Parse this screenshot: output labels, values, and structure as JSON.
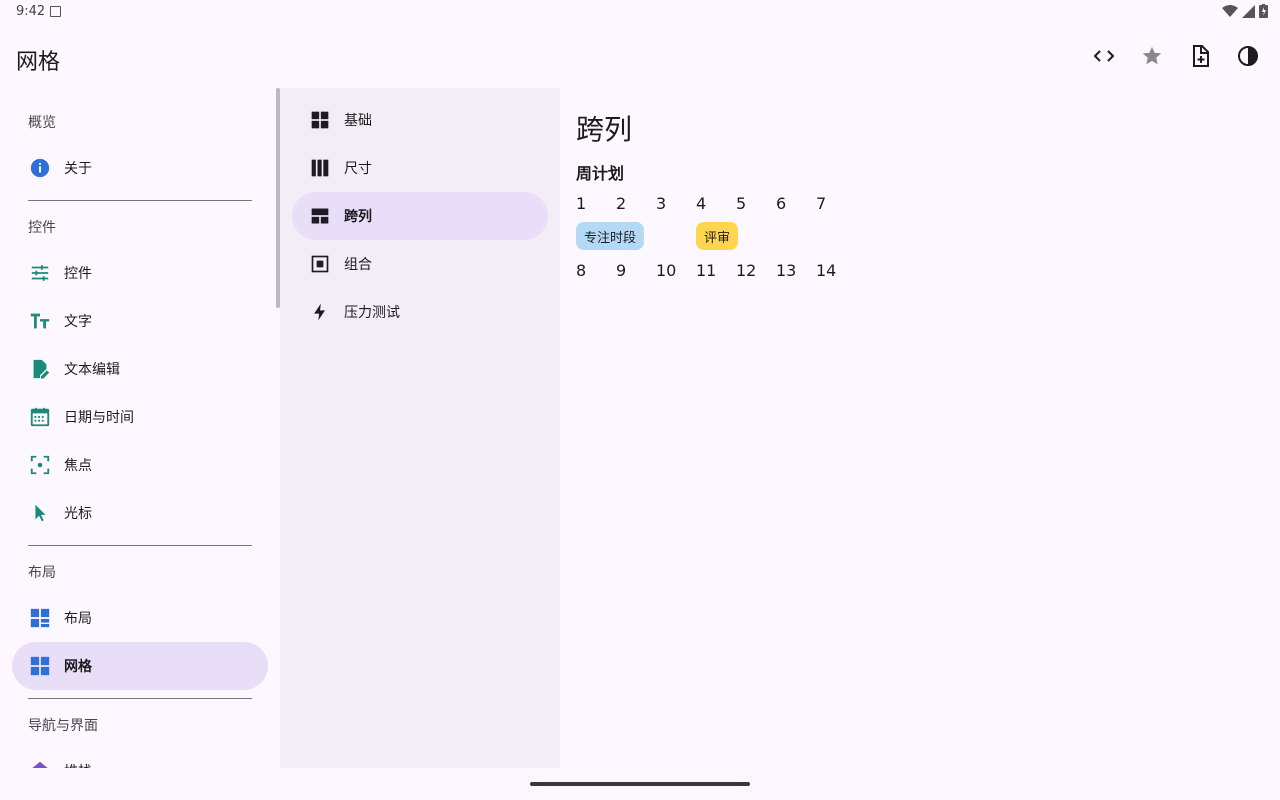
{
  "status": {
    "time": "9:42"
  },
  "appbar": {
    "title": "网格",
    "actions": [
      {
        "name": "code-icon"
      },
      {
        "name": "star-icon"
      },
      {
        "name": "note-add-icon"
      },
      {
        "name": "contrast-icon"
      }
    ]
  },
  "nav": {
    "sections": {
      "overview": "概览",
      "controls": "控件",
      "layout": "布局",
      "navigation": "导航与界面"
    },
    "items": {
      "about": "关于",
      "controls": "控件",
      "text": "文字",
      "text_edit": "文本编辑",
      "datetime": "日期与时间",
      "focus": "焦点",
      "cursor": "光标",
      "layout": "布局",
      "grid": "网格",
      "partial": "堆栈"
    },
    "active": "grid"
  },
  "sub": {
    "items": {
      "basic": "基础",
      "size": "尺寸",
      "span": "跨列",
      "combo": "组合",
      "stress": "压力测试"
    },
    "active": "span"
  },
  "content": {
    "title": "跨列",
    "section": "周计划",
    "week1": [
      "1",
      "2",
      "3",
      "4",
      "5",
      "6",
      "7"
    ],
    "chips": [
      {
        "label": "专注时段",
        "color": "#b3d9f7"
      },
      {
        "label": "评审",
        "color": "#ffd54f"
      }
    ],
    "week2": [
      "8",
      "9",
      "10",
      "11",
      "12",
      "13",
      "14"
    ]
  },
  "colors": {
    "background": "#fdf7ff",
    "active_indicator": "#e8def8",
    "secondary_panel": "#f3edf7",
    "icon_teal": "#1a8a7a",
    "icon_blue": "#2f6fd6"
  }
}
